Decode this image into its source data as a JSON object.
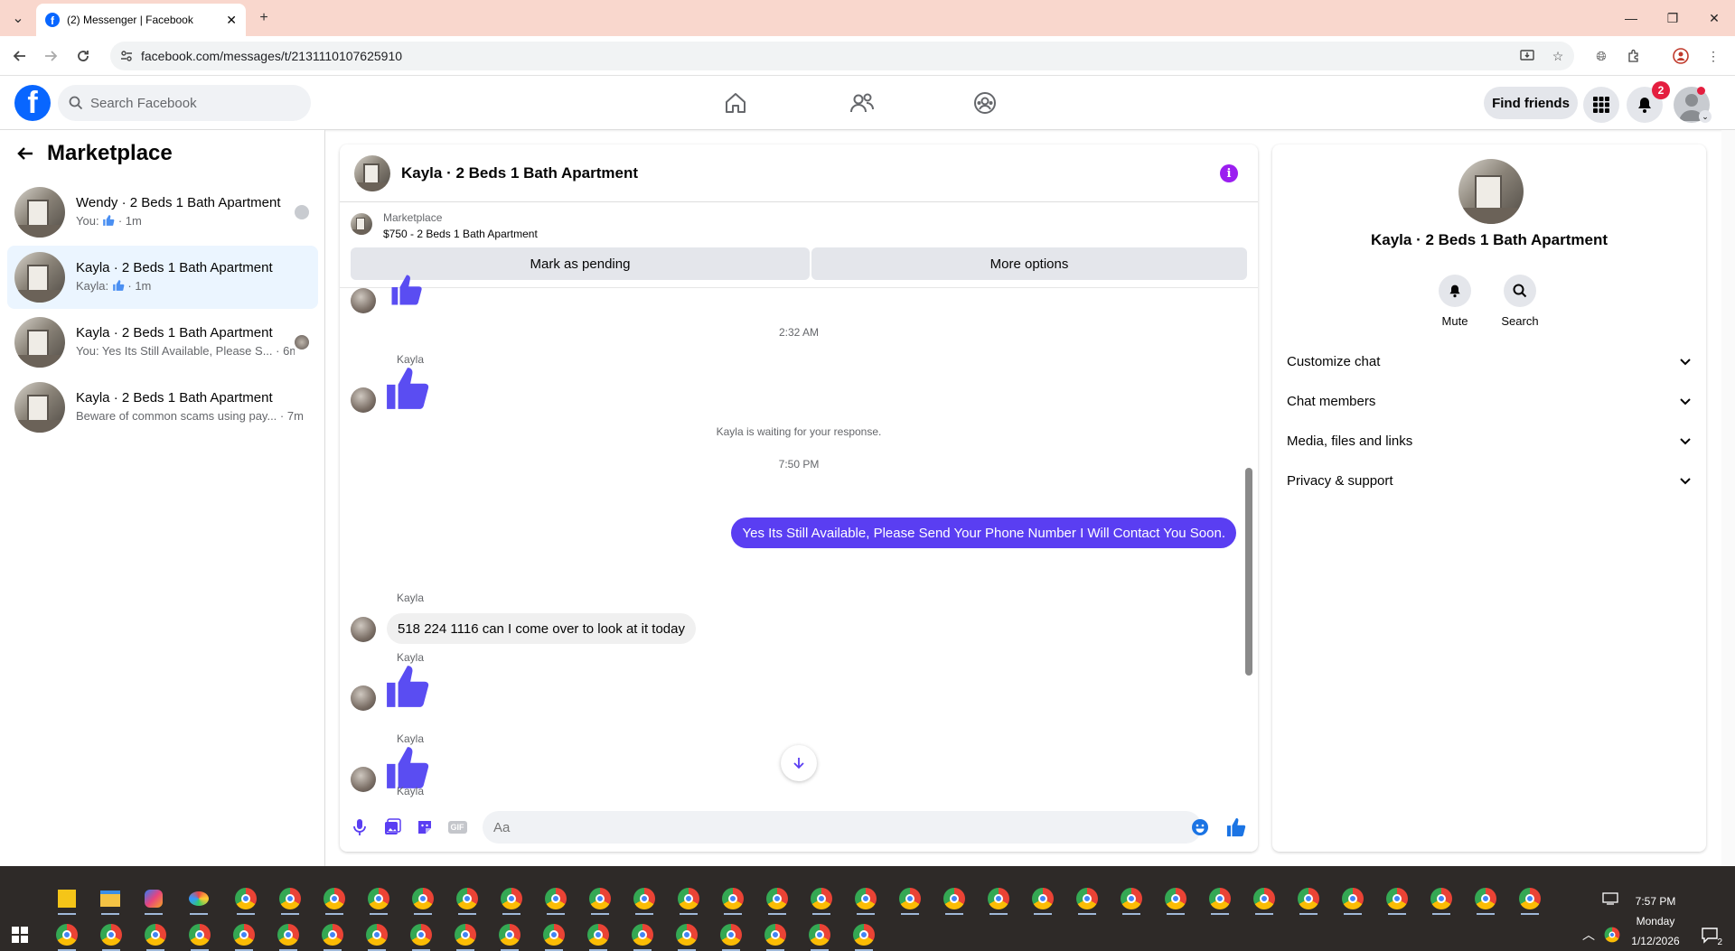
{
  "browser": {
    "tab_title": "(2) Messenger | Facebook",
    "url": "facebook.com/messages/t/2131110107625910"
  },
  "fb_header": {
    "logo_letter": "f",
    "search_placeholder": "Search Facebook",
    "find_friends": "Find friends",
    "notifications_count": "2"
  },
  "sidebar": {
    "title": "Marketplace",
    "conversations": [
      {
        "title": "Wendy · 2 Beds 1 Bath Apartment",
        "prefix": "You:",
        "time": "· 1m",
        "active": false
      },
      {
        "title": "Kayla · 2 Beds 1 Bath Apartment",
        "prefix": "Kayla:",
        "time": "· 1m",
        "active": true
      },
      {
        "title": "Kayla · 2 Beds 1 Bath Apartment",
        "snippet": "You: Yes Its Still Available, Please S...",
        "time": "· 6m",
        "active": false
      },
      {
        "title": "Kayla · 2 Beds 1 Bath Apartment",
        "snippet": "Beware of common scams using pay...",
        "time": "· 7m",
        "active": false
      }
    ]
  },
  "chat": {
    "title": "Kayla · 2 Beds 1 Bath Apartment",
    "marketplace_label": "Marketplace",
    "listing": "$750 - 2 Beds 1 Bath Apartment",
    "mark_pending": "Mark as pending",
    "more_options": "More options",
    "timestamp_1": "2:32 AM",
    "sender": "Kayla",
    "waiting_notice": "Kayla is waiting for your response.",
    "timestamp_2": "7:50 PM",
    "outgoing_message": "Yes Its Still Available, Please Send Your Phone Number I Will Contact You Soon.",
    "incoming_message": "518 224 1116 can I come over to look at it today",
    "input_placeholder": "Aa"
  },
  "info_panel": {
    "title": "Kayla · 2 Beds 1 Bath Apartment",
    "mute_label": "Mute",
    "search_label": "Search",
    "sections": [
      "Customize chat",
      "Chat members",
      "Media, files and links",
      "Privacy & support"
    ]
  },
  "taskbar": {
    "time": "7:57 PM",
    "day": "Monday",
    "date": "1/12/2026",
    "notification_count": "2"
  },
  "colors": {
    "accent": "#5a3ef2",
    "fb_blue": "#0866ff",
    "active_row": "#ebf5ff",
    "tab_strip": "#f9d7cd"
  }
}
